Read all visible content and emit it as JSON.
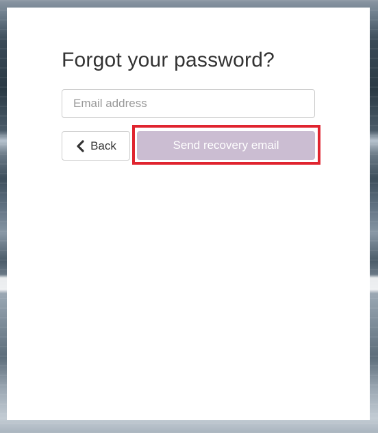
{
  "form": {
    "title": "Forgot your password?",
    "email_placeholder": "Email address",
    "email_value": ""
  },
  "buttons": {
    "back_label": "Back",
    "back_icon": "chevron-left-icon",
    "send_label": "Send recovery email",
    "send_state": "disabled"
  },
  "colors": {
    "send_button_bg": "#cbbdd2",
    "highlight_border": "#e0242f",
    "title_text": "#333333"
  }
}
